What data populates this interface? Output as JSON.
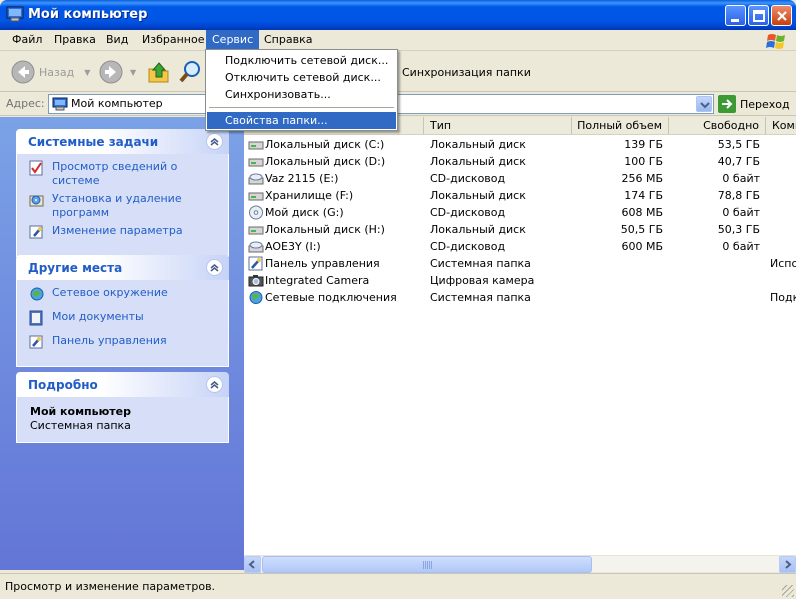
{
  "window": {
    "title": "Мой компьютер"
  },
  "menu": {
    "items": [
      "Файл",
      "Правка",
      "Вид",
      "Избранное",
      "Сервис",
      "Справка"
    ],
    "active": "Сервис"
  },
  "service_menu": {
    "items": [
      "Подключить сетевой диск...",
      "Отключить сетевой диск...",
      "Синхронизовать...",
      "Свойства папки..."
    ],
    "highlighted": "Свойства папки..."
  },
  "toolbar": {
    "back": "Назад",
    "sync": "Синхронизация папки"
  },
  "address": {
    "label": "Адрес:",
    "value": "Мой компьютер",
    "go": "Переход"
  },
  "sidebar": {
    "system_tasks": {
      "title": "Системные задачи",
      "items": [
        {
          "label": "Просмотр сведений о системе",
          "icon": "system-info-icon"
        },
        {
          "label": "Установка и удаление программ",
          "icon": "add-remove-programs-icon"
        },
        {
          "label": "Изменение параметра",
          "icon": "change-setting-icon"
        }
      ]
    },
    "other_places": {
      "title": "Другие места",
      "items": [
        {
          "label": "Сетевое окружение",
          "icon": "network-places-icon"
        },
        {
          "label": "Мои документы",
          "icon": "my-documents-icon"
        },
        {
          "label": "Панель управления",
          "icon": "control-panel-icon"
        }
      ]
    },
    "details": {
      "title": "Подробно",
      "name": "Мой компьютер",
      "type": "Системная папка"
    }
  },
  "columns": {
    "type": "Тип",
    "total": "Полный объем",
    "free": "Свободно",
    "comment": "Комм"
  },
  "files": [
    {
      "name": "Локальный диск (C:)",
      "type": "Локальный диск",
      "total": "139 ГБ",
      "free": "53,5 ГБ",
      "comment": "",
      "icon": "hard-drive-icon"
    },
    {
      "name": "Локальный диск (D:)",
      "type": "Локальный диск",
      "total": "100 ГБ",
      "free": "40,7 ГБ",
      "comment": "",
      "icon": "hard-drive-icon"
    },
    {
      "name": "Vaz 2115 (E:)",
      "type": "CD-дисковод",
      "total": "256 МБ",
      "free": "0 байт",
      "comment": "",
      "icon": "cd-drive-icon"
    },
    {
      "name": "Хранилище (F:)",
      "type": "Локальный диск",
      "total": "174 ГБ",
      "free": "78,8 ГБ",
      "comment": "",
      "icon": "hard-drive-icon"
    },
    {
      "name": "Мой диск (G:)",
      "type": "CD-дисковод",
      "total": "608 МБ",
      "free": "0 байт",
      "comment": "",
      "icon": "cd-disc-icon"
    },
    {
      "name": "Локальный диск (H:)",
      "type": "Локальный диск",
      "total": "50,5 ГБ",
      "free": "50,3 ГБ",
      "comment": "",
      "icon": "hard-drive-icon"
    },
    {
      "name": "AOE3Y (I:)",
      "type": "CD-дисковод",
      "total": "600 МБ",
      "free": "0 байт",
      "comment": "",
      "icon": "cd-drive-icon"
    },
    {
      "name": "Панель управления",
      "type": "Системная папка",
      "total": "",
      "free": "",
      "comment": "Испо",
      "icon": "control-panel-icon"
    },
    {
      "name": "Integrated Camera",
      "type": "Цифровая камера",
      "total": "",
      "free": "",
      "comment": "",
      "icon": "camera-icon"
    },
    {
      "name": "Сетевые подключения",
      "type": "Системная папка",
      "total": "",
      "free": "",
      "comment": "Подк",
      "icon": "network-connections-icon"
    }
  ],
  "status": {
    "text": "Просмотр и изменение параметров."
  },
  "colors": {
    "title_blue": "#0055e5",
    "menu_highlight": "#316ac5",
    "task_link": "#215dc6",
    "pane_bg": "#6375d6"
  }
}
